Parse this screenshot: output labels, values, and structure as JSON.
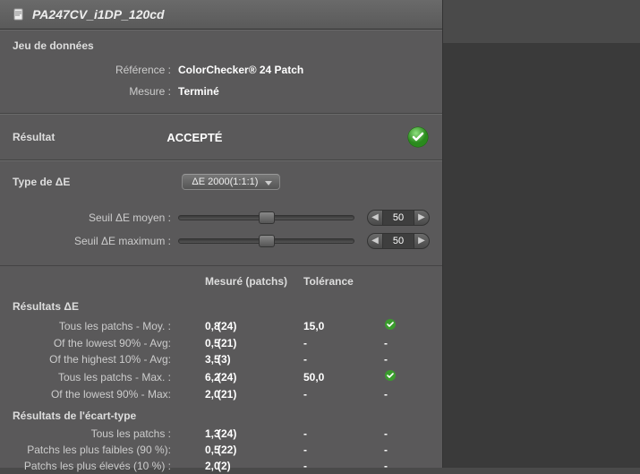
{
  "header": {
    "title": "PA247CV_i1DP_120cd"
  },
  "dataset": {
    "title": "Jeu de données",
    "reference_label": "Référence :",
    "reference_value": "ColorChecker® 24 Patch",
    "measure_label": "Mesure :",
    "measure_value": "Terminé"
  },
  "result": {
    "label": "Résultat",
    "value": "ACCEPTÉ"
  },
  "deltaE": {
    "type_label": "Type de ΔE",
    "type_value": "ΔE 2000(1:1:1)",
    "avg_threshold_label": "Seuil ΔE moyen :",
    "avg_threshold_value": "50",
    "max_threshold_label": "Seuil ΔE maximum :",
    "max_threshold_value": "50"
  },
  "columns": {
    "measured": "Mesuré (patchs)",
    "tolerance": "Tolérance"
  },
  "de_results": {
    "title": "Résultats ΔE",
    "rows": [
      {
        "label": "Tous les patchs - Moy. :",
        "v1": "0,8",
        "v2": "(24)",
        "tol": "15,0",
        "ok": true
      },
      {
        "label": "Of the lowest 90% - Avg:",
        "v1": "0,5",
        "v2": "(21)",
        "tol": "-",
        "ok": "-"
      },
      {
        "label": "Of the highest 10% - Avg:",
        "v1": "3,5",
        "v2": "(3)",
        "tol": "-",
        "ok": "-"
      }
    ],
    "rows2": [
      {
        "label": "Tous les patchs - Max. :",
        "v1": "6,2",
        "v2": "(24)",
        "tol": "50,0",
        "ok": true
      },
      {
        "label": "Of the lowest 90% - Max:",
        "v1": "2,0",
        "v2": "(21)",
        "tol": "-",
        "ok": "-"
      }
    ]
  },
  "std_results": {
    "title": "Résultats de l'écart-type",
    "rows": [
      {
        "label": "Tous les patchs :",
        "v1": "1,3",
        "v2": "(24)",
        "tol": "-",
        "ok": "-"
      },
      {
        "label": "Patchs les plus faibles (90 %):",
        "v1": "0,5",
        "v2": "(22)",
        "tol": "-",
        "ok": "-"
      },
      {
        "label": "Patchs les plus élevés (10 %) :",
        "v1": "2,0",
        "v2": "(2)",
        "tol": "-",
        "ok": "-"
      }
    ]
  }
}
